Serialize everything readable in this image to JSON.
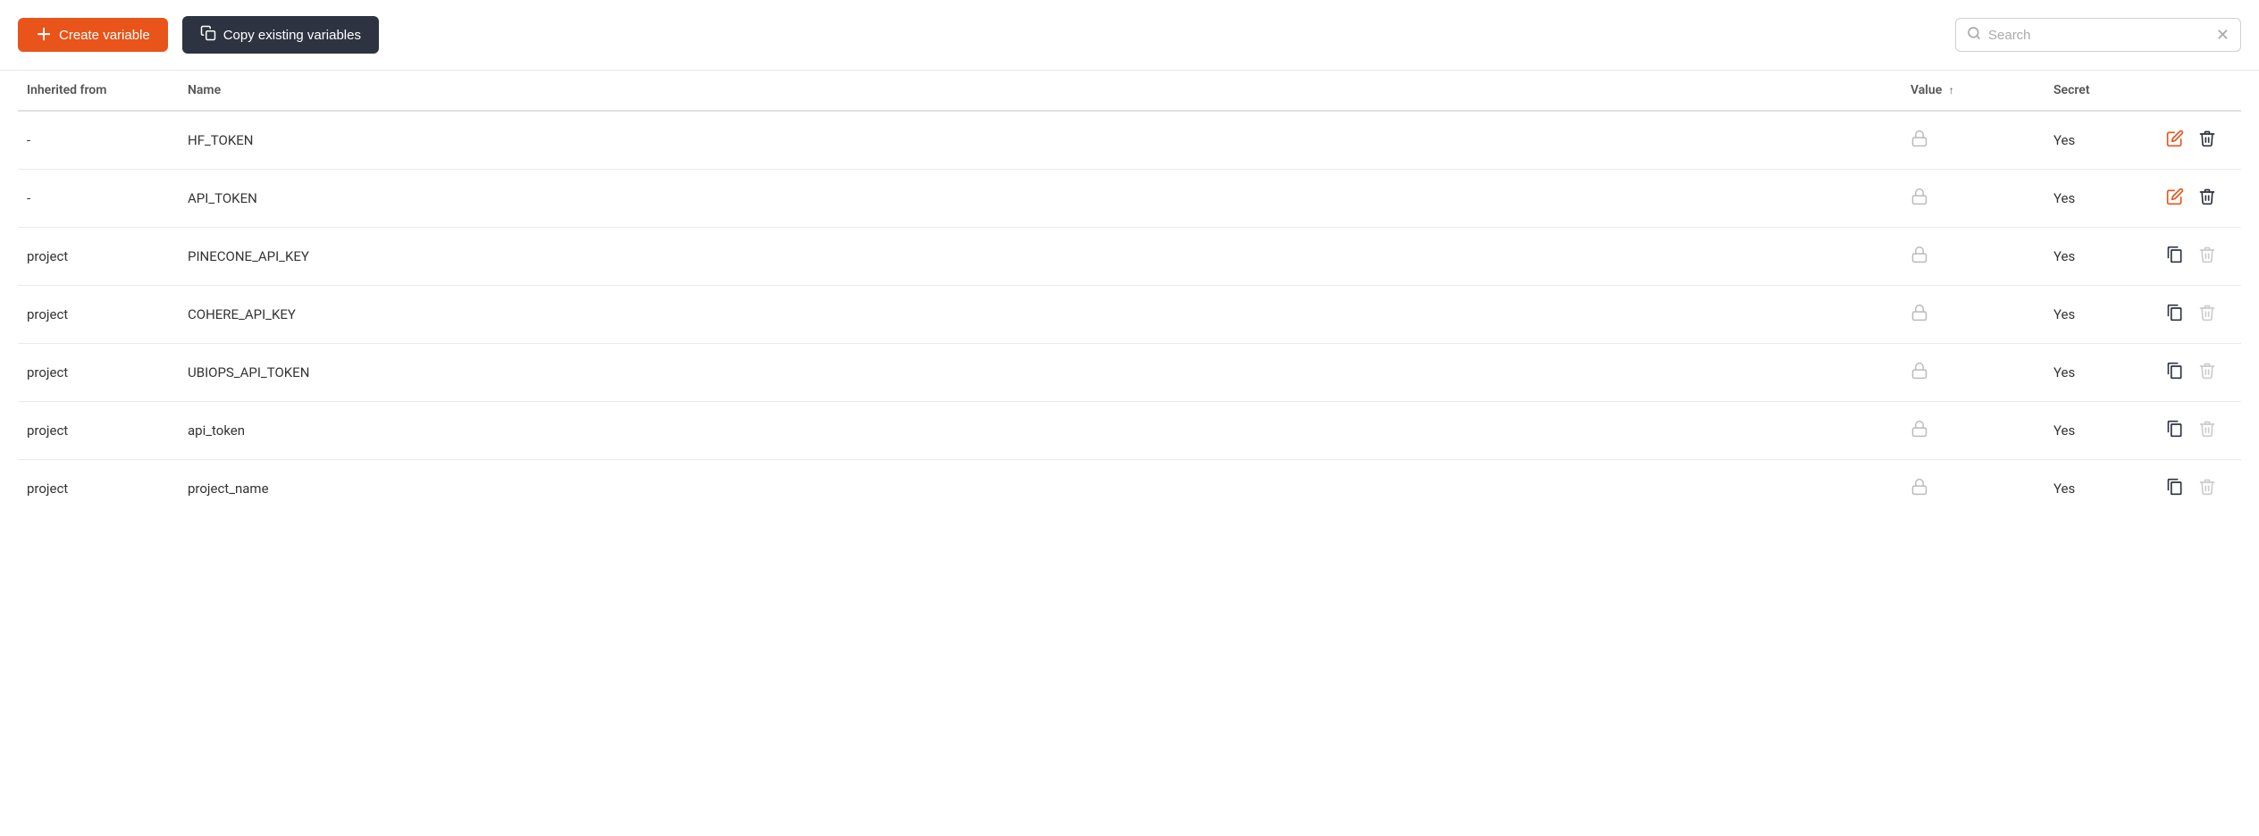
{
  "toolbar": {
    "create_label": "Create variable",
    "copy_label": "Copy existing variables",
    "search_placeholder": "Search"
  },
  "table": {
    "columns": {
      "inherited_from": "Inherited from",
      "name": "Name",
      "value": "Value",
      "secret": "Secret"
    },
    "rows": [
      {
        "inherited_from": "-",
        "name": "HF_TOKEN",
        "secret": "Yes",
        "editable": true,
        "deletable": true
      },
      {
        "inherited_from": "-",
        "name": "API_TOKEN",
        "secret": "Yes",
        "editable": true,
        "deletable": true
      },
      {
        "inherited_from": "project",
        "name": "PINECONE_API_KEY",
        "secret": "Yes",
        "editable": false,
        "deletable": false
      },
      {
        "inherited_from": "project",
        "name": "COHERE_API_KEY",
        "secret": "Yes",
        "editable": false,
        "deletable": false
      },
      {
        "inherited_from": "project",
        "name": "UBIOPS_API_TOKEN",
        "secret": "Yes",
        "editable": false,
        "deletable": false
      },
      {
        "inherited_from": "project",
        "name": "api_token",
        "secret": "Yes",
        "editable": false,
        "deletable": false
      },
      {
        "inherited_from": "project",
        "name": "project_name",
        "secret": "Yes",
        "editable": false,
        "deletable": false
      }
    ]
  }
}
